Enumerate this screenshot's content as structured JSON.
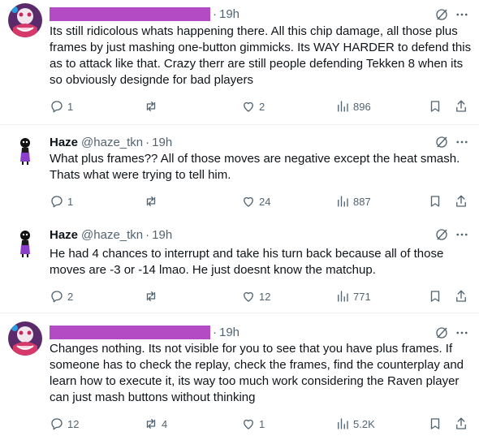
{
  "posts": [
    {
      "author_redacted": true,
      "time": "19h",
      "text": "Its still ridicolous whats happening there. All this chip damage, all those plus frames by just mashing one-button gimmicks. Its WAY HARDER to defend this as to attack like that. Crazy therr are still people defending Tekken 8 when its so obviously designde for bad players",
      "replies": "1",
      "reposts": "",
      "likes": "2",
      "views": "896"
    },
    {
      "author_name": "Haze",
      "handle": "@haze_tkn",
      "time": "19h",
      "text": "What plus frames?? All of those moves are negative except the heat smash. Thats what were trying to tell him.",
      "replies": "1",
      "reposts": "",
      "likes": "24",
      "views": "887"
    },
    {
      "author_name": "Haze",
      "handle": "@haze_tkn",
      "time": "19h",
      "text": "He had 4 chances to interrupt and take his turn back because all of those moves are -3 or -14 lmao. He just doesnt know the matchup.",
      "replies": "2",
      "reposts": "",
      "likes": "12",
      "views": "771"
    },
    {
      "author_redacted": true,
      "time": "19h",
      "text": "Changes nothing. Its not visible for you to see that you have plus frames. If someone has to check the replay, check the frames, find the counterplay and learn how to execute it, its way too much work considering the Raven player can just mash buttons without thinking",
      "replies": "12",
      "reposts": "4",
      "likes": "1",
      "views": "5.2K"
    }
  ],
  "colors": {
    "redaction": "#b34cc4",
    "secondary": "#536471",
    "divider": "#eff3f4"
  },
  "icons": [
    "grok-icon",
    "more-icon",
    "reply-icon",
    "repost-icon",
    "like-icon",
    "views-icon",
    "bookmark-icon",
    "share-icon"
  ]
}
